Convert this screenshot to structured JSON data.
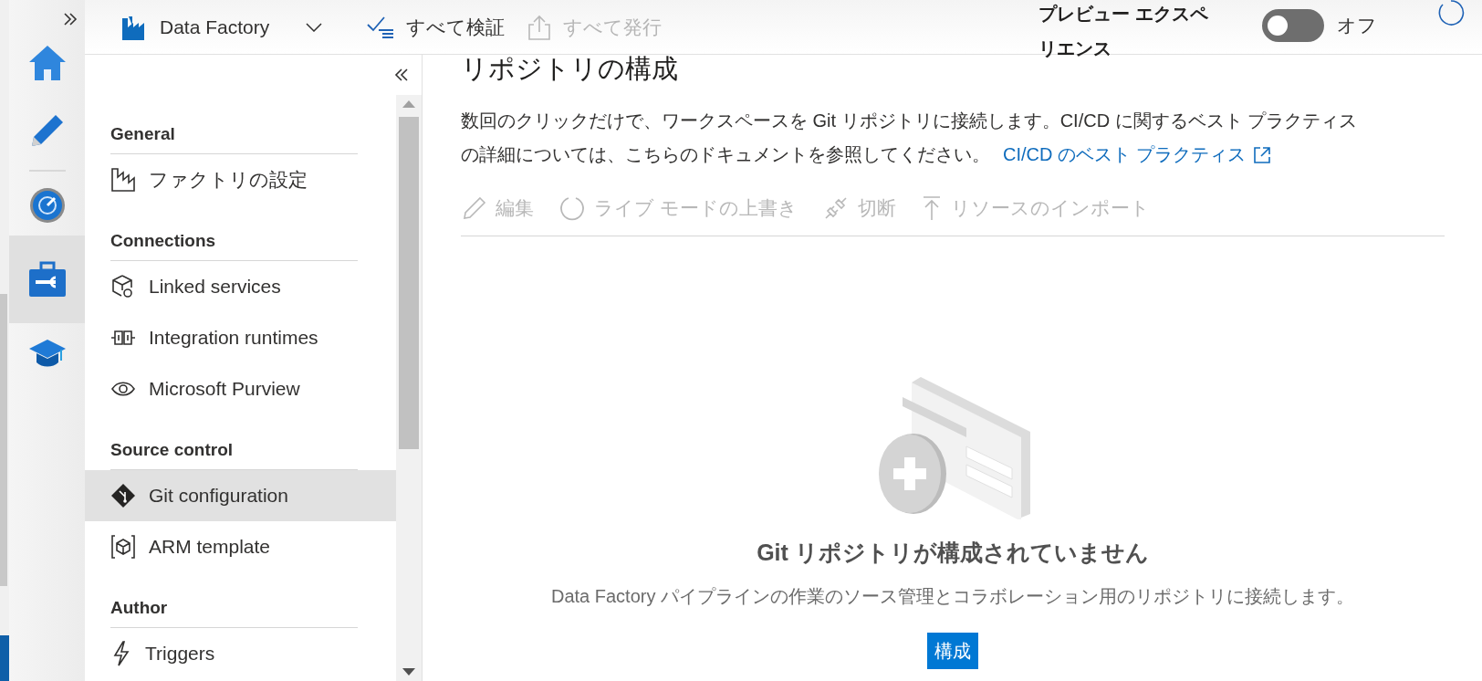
{
  "rail_items": [
    {
      "selected": false
    },
    {
      "selected": false
    },
    {
      "selected": false
    },
    {
      "selected": true
    },
    {
      "selected": false
    }
  ],
  "top_bar": {
    "factory_name": "Data Factory",
    "actions": [
      {
        "label": "すべて検証",
        "disabled": false
      },
      {
        "label": "すべて発行",
        "disabled": true
      }
    ],
    "preview_label": "プレビュー エクスペリエンス",
    "preview_toggle": {
      "on": false,
      "label": "オフ"
    }
  },
  "sidebar": {
    "sections": [
      {
        "heading": "General",
        "items": [
          {
            "label": "ファクトリの設定",
            "selected": false
          }
        ]
      },
      {
        "heading": "Connections",
        "items": [
          {
            "label": "Linked services",
            "selected": false
          },
          {
            "label": "Integration runtimes",
            "selected": false
          },
          {
            "label": "Microsoft Purview",
            "selected": false
          }
        ]
      },
      {
        "heading": "Source control",
        "items": [
          {
            "label": "Git configuration",
            "selected": true
          },
          {
            "label": "ARM template",
            "selected": false
          }
        ]
      },
      {
        "heading": "Author",
        "items": [
          {
            "label": "Triggers",
            "selected": false
          }
        ]
      }
    ]
  },
  "content": {
    "title": "リポジトリの構成",
    "description": "数回のクリックだけで、ワークスペースを Git リポジトリに接続します。CI/CD に関するベスト プラクティスの詳細については、こちらのドキュメントを参照してください。",
    "link": "CI/CD のベスト プラクティス",
    "toolbar": [
      {
        "label": "編集",
        "disabled": true
      },
      {
        "label": "ライブ モードの上書き",
        "disabled": true
      },
      {
        "label": "切断",
        "disabled": true
      },
      {
        "label": "リソースのインポート",
        "disabled": true
      }
    ],
    "empty_state": {
      "heading": "Git リポジトリが構成されていません",
      "text": "Data Factory パイプラインの作業のソース管理とコラボレーション用のリポジトリに接続します。",
      "button": "構成"
    }
  }
}
